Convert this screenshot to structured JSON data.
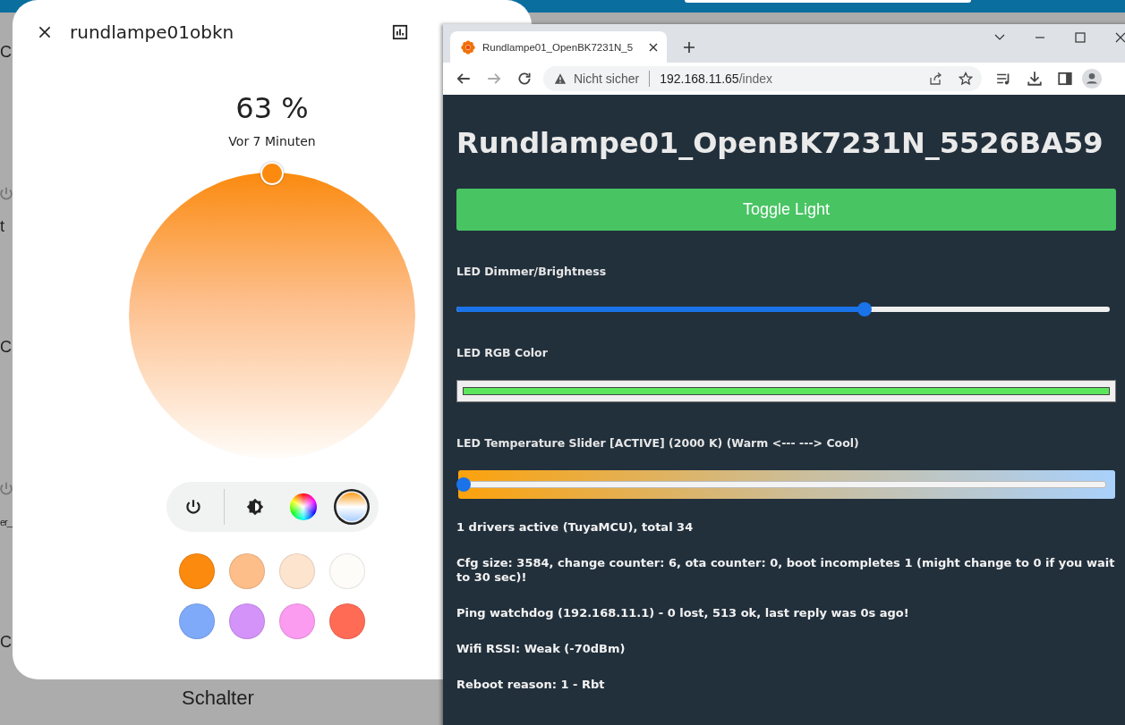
{
  "background": {
    "labels": [
      {
        "kind": "text",
        "text": "C"
      },
      {
        "kind": "power"
      },
      {
        "kind": "text",
        "text": "t"
      },
      {
        "kind": "text",
        "text": "C"
      },
      {
        "kind": "power"
      },
      {
        "kind": "text",
        "text": "er_"
      },
      {
        "kind": "text",
        "text": "C"
      }
    ],
    "section_title": "Schalter"
  },
  "dialog": {
    "title": "rundlampe01obkn",
    "value": "63 %",
    "last_changed": "Vor 7 Minuten",
    "modes": [
      {
        "kind": "power",
        "selected": false
      },
      {
        "kind": "brightness",
        "selected": false
      },
      {
        "kind": "color",
        "selected": false
      },
      {
        "kind": "temperature",
        "selected": true
      }
    ],
    "presets": [
      {
        "color": "#fb8a0f"
      },
      {
        "color": "#fdbe8a"
      },
      {
        "color": "#fde4cf"
      },
      {
        "color": "#fefcf9"
      },
      {
        "color": "#7faafa"
      },
      {
        "color": "#d493f9"
      },
      {
        "color": "#fb9cf0"
      },
      {
        "color": "#ff6b55"
      }
    ]
  },
  "browser": {
    "tab_title": "Rundlampe01_OpenBK7231N_5",
    "security": "Nicht sicher",
    "url_host": "192.168.11.65",
    "url_path": "/index",
    "page": {
      "heading": "Rundlampe01_OpenBK7231N_5526BA59",
      "toggle_button": "Toggle Light",
      "dimmer": {
        "label": "LED Dimmer/Brightness",
        "level": 0.625
      },
      "rgb": {
        "label": "LED RGB Color",
        "color": "#5ce65c"
      },
      "temperature": {
        "label": "LED Temperature Slider [ACTIVE] (2000 K) (Warm <--- ---> Cool)",
        "level": 0.0
      },
      "info": [
        "1 drivers active (TuyaMCU), total 34",
        "Cfg size: 3584, change counter: 6, ota counter: 0, boot incompletes 1 (might change to 0 if you wait to 30 sec)!",
        "Ping watchdog (192.168.11.1) - 0 lost, 513 ok, last reply was 0s ago!",
        "Wifi RSSI: Weak (-70dBm)",
        "Reboot reason: 1 - Rbt"
      ]
    }
  }
}
